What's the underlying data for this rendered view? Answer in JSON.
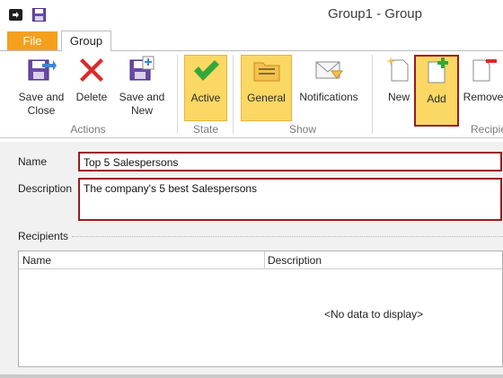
{
  "window": {
    "title": "Group1 - Group"
  },
  "tabs": {
    "file": "File",
    "group": "Group"
  },
  "ribbon": {
    "save_close": "Save and\nClose",
    "delete": "Delete",
    "save_new": "Save and\nNew",
    "active": "Active",
    "general": "General",
    "notifications": "Notifications",
    "new": "New",
    "add": "Add",
    "remove": "Remove",
    "groups": {
      "actions": "Actions",
      "state": "State",
      "show": "Show",
      "recipients": "Recipients"
    }
  },
  "form": {
    "name_label": "Name",
    "name_value": "Top 5 Salespersons",
    "description_label": "Description",
    "description_value": "The company's 5 best Salespersons",
    "recipients_label": "Recipients"
  },
  "grid": {
    "columns": [
      "Name",
      "Description"
    ],
    "empty_text": "<No data to display>"
  },
  "colors": {
    "file_tab": "#f4a01c",
    "pressed": "#fbd863",
    "highlight": "#9b1b1b"
  }
}
